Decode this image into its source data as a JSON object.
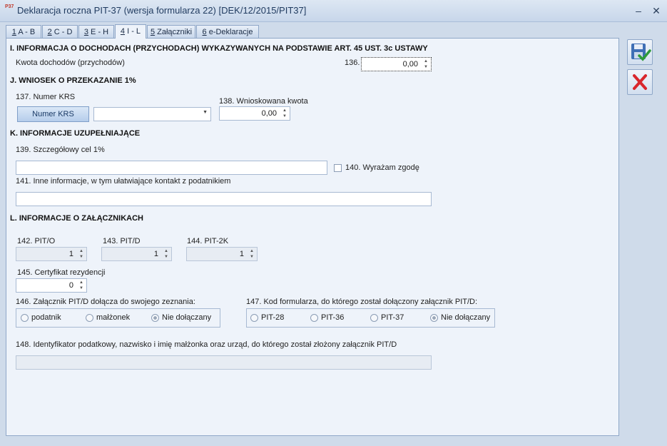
{
  "window": {
    "title": "Deklaracja roczna PIT-37 (wersja formularza 22) [DEK/12/2015/PIT37]",
    "icon_text": "P37",
    "minimize": "–",
    "close": "✕"
  },
  "tabs": [
    {
      "key": "1",
      "label": " A - B"
    },
    {
      "key": "2",
      "label": " C - D"
    },
    {
      "key": "3",
      "label": " E - H"
    },
    {
      "key": "4",
      "label": " I - L"
    },
    {
      "key": "5",
      "label": " Załączniki"
    },
    {
      "key": "6",
      "label": " e-Deklaracje"
    }
  ],
  "section_i": {
    "heading": "I. INFORMACJA O DOCHODACH (PRZYCHODACH) WYKAZYWANYCH NA PODSTAWIE ART. 45 UST. 3c USTAWY",
    "label": "Kwota dochodów (przychodów)",
    "field_no": "136.",
    "value": "0,00"
  },
  "section_j": {
    "heading": "J. WNIOSEK O PRZEKAZANIE 1%",
    "krs_label": "137. Numer KRS",
    "krs_button": "Numer KRS",
    "krs_value": "",
    "amount_label": "138. Wnioskowana kwota",
    "amount_value": "0,00"
  },
  "section_k": {
    "heading": "K. INFORMACJE UZUPEŁNIAJĄCE",
    "goal_label": "139. Szczegółowy cel 1%",
    "goal_value": "",
    "consent_label": "140. Wyrażam zgodę",
    "other_label": "141. Inne informacje, w tym ułatwiające kontakt z podatnikiem",
    "other_value": ""
  },
  "section_l": {
    "heading": "L. INFORMACJE O ZAŁĄCZNIKACH",
    "pito_label": "142. PIT/O",
    "pito_value": "1",
    "pitd_label": "143. PIT/D",
    "pitd_value": "1",
    "pit2k_label": "144. PIT-2K",
    "pit2k_value": "1",
    "cert_label": "145. Certyfikat rezydencji",
    "cert_value": "0",
    "attach_label": "146. Załącznik PIT/D dołącza do swojego zeznania:",
    "attach_options": [
      "podatnik",
      "małżonek",
      "Nie dołączany"
    ],
    "attach_selected": "Nie dołączany",
    "form_code_label": "147. Kod formularza, do którego został dołączony załącznik PIT/D:",
    "form_code_options": [
      "PIT-28",
      "PIT-36",
      "PIT-37",
      "Nie dołączany"
    ],
    "form_code_selected": "Nie dołączany",
    "spouse_label": "148. Identyfikator podatkowy, nazwisko i imię małżonka oraz urząd, do którego został złożony załącznik PIT/D",
    "spouse_value": ""
  },
  "actions": {
    "save_icon": "save-icon",
    "cancel_icon": "cancel-icon"
  }
}
